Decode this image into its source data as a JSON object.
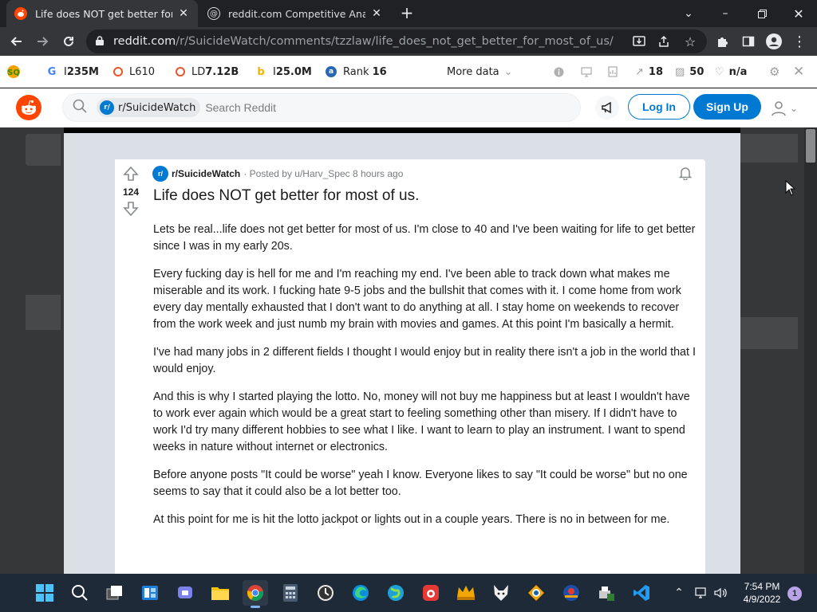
{
  "browser": {
    "tabs": [
      {
        "title": "Life does NOT get better for mos",
        "active": true
      },
      {
        "title": "reddit.com Competitive Analysis,",
        "active": false
      }
    ],
    "url_host": "reddit.com",
    "url_path": "/r/SuicideWatch/comments/tzzlaw/life_does_not_get_better_for_most_of_us/"
  },
  "seo_bar": {
    "google_index": "235M",
    "links": "610",
    "linking_domains": "7.12B",
    "bing_index": "25.0M",
    "rank_label": "Rank",
    "rank_value": "16",
    "more_data": "More data",
    "external_links": "18",
    "pages": "50",
    "score": "n/a",
    "prefix_i": "I",
    "prefix_l": "L",
    "prefix_ld": "LD",
    "prefix_bi": "I"
  },
  "reddit_header": {
    "subreddit_chip": "r/SuicideWatch",
    "search_placeholder": "Search Reddit",
    "login_label": "Log In",
    "signup_label": "Sign Up"
  },
  "post": {
    "votes": "124",
    "subreddit": "r/SuicideWatch",
    "meta": "· Posted by u/Harv_Spec 8 hours ago",
    "title": "Life does NOT get better for most of us.",
    "paragraphs": [
      "Lets be real...life does not get better for most of us. I'm close to 40 and I've been waiting for life to get better since I was in my early 20s.",
      "Every fucking day is hell for me and I'm reaching my end. I've been able to track down what makes me miserable and its work. I fucking hate 9-5 jobs and the bullshit that comes with it. I come home from work every day mentally exhausted that I don't want to do anything at all. I stay home on weekends to recover from the work week and just numb my brain with movies and games. At this point I'm basically a hermit.",
      "I've had many jobs in 2 different fields I thought I would enjoy but in reality there isn't a job in the world that I would enjoy.",
      "And this is why I started playing the lotto. No, money will not buy me happiness but at least I wouldn't have to work ever again which would be a great start to feeling something other than misery. If I didn't have to work I'd try many different hobbies to see what I like. I want to learn to play an instrument. I want to spend weeks in nature without internet or electronics.",
      "Before anyone posts \"It could be worse\" yeah I know. Everyone likes to say \"It could be worse\" but no one seems to say that it could also be a lot better too.",
      "At this point for me is hit the lotto jackpot or lights out in a couple years. There is no in between for me."
    ]
  },
  "taskbar": {
    "time": "7:54 PM",
    "date": "4/9/2022",
    "notifications": "1"
  },
  "colors": {
    "reddit_orange": "#ff4500",
    "reddit_blue": "#0079d3",
    "chrome_dark": "#202124",
    "taskbar": "#1f2a38"
  }
}
